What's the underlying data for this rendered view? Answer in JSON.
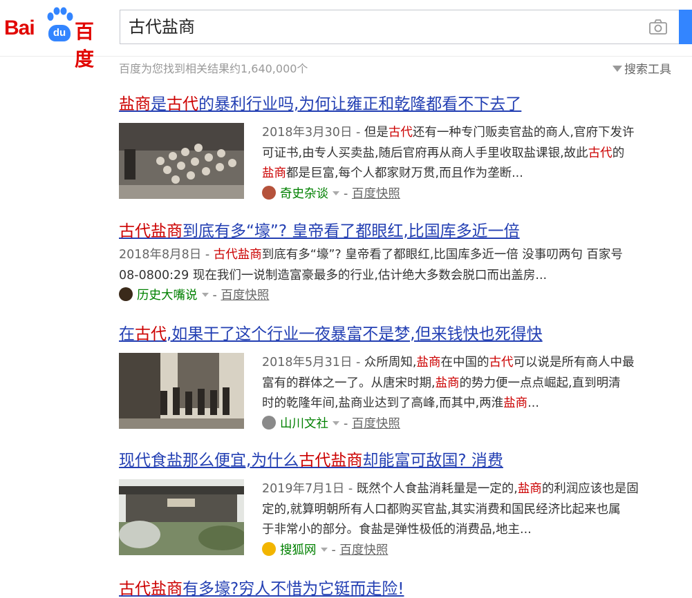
{
  "header": {
    "logo": {
      "bai": "Bai",
      "du": "du",
      "cn": "百度"
    },
    "search": {
      "query": "古代盐商"
    },
    "count_text": "百度为您找到相关结果约1,640,000个",
    "tools_label": "搜索工具"
  },
  "results": [
    {
      "title": [
        {
          "t": "盐商",
          "hl": true
        },
        {
          "t": "是"
        },
        {
          "t": "古代",
          "hl": true
        },
        {
          "t": "的暴利行业吗,为何让雍正和乾隆都看不下去了"
        }
      ],
      "lines": [
        [
          {
            "t": "2018年3月30日 - ",
            "date": true
          },
          {
            "t": "但是"
          },
          {
            "t": "古代",
            "hl": true
          },
          {
            "t": "还有一种专门贩卖官盐的商人,官府下发许"
          }
        ],
        [
          {
            "t": "可证书,由专人买卖盐,随后官府再从商人手里收取盐课银,故此"
          },
          {
            "t": "古代",
            "hl": true
          },
          {
            "t": "的"
          }
        ],
        [
          {
            "t": "盐商",
            "hl": true
          },
          {
            "t": "都是巨富,每个人都家财万贯,而且作为垄断..."
          }
        ]
      ],
      "source": "奇史杂谈",
      "cache": "百度快照",
      "favicon_color": "#b5523b"
    },
    {
      "title": [
        {
          "t": "古代盐商",
          "hl": true
        },
        {
          "t": "到底有多“壕”? 皇帝看了都眼红,比国库多近一倍"
        }
      ],
      "lines": [
        [
          {
            "t": "2018年8月8日 - ",
            "date": true
          },
          {
            "t": "古代盐商",
            "hl": true
          },
          {
            "t": "到底有多“壕”? 皇帝看了都眼红,比国库多近一倍 没事叨两句 百家号"
          }
        ],
        [
          {
            "t": "08-0800:29 现在我们一说制造富豪最多的行业,估计绝大多数会脱口而出盖房..."
          }
        ]
      ],
      "source": "历史大嘴说",
      "cache": "百度快照",
      "favicon_color": "#3a2a1a"
    },
    {
      "title": [
        {
          "t": "在"
        },
        {
          "t": "古代",
          "hl": true
        },
        {
          "t": ",如果干了这个行业一夜暴富不是梦,但来钱快也死得快"
        }
      ],
      "lines": [
        [
          {
            "t": "2018年5月31日 - ",
            "date": true
          },
          {
            "t": "众所周知,"
          },
          {
            "t": "盐商",
            "hl": true
          },
          {
            "t": "在中国的"
          },
          {
            "t": "古代",
            "hl": true
          },
          {
            "t": "可以说是所有商人中最"
          }
        ],
        [
          {
            "t": "富有的群体之一了。从唐宋时期,"
          },
          {
            "t": "盐商",
            "hl": true
          },
          {
            "t": "的势力便一点点崛起,直到明清"
          }
        ],
        [
          {
            "t": "时的乾隆年间,盐商业达到了高峰,而其中,两淮"
          },
          {
            "t": "盐商",
            "hl": true
          },
          {
            "t": "..."
          }
        ]
      ],
      "source": "山川文社",
      "cache": "百度快照",
      "favicon_color": "#8a8a8a"
    },
    {
      "title": [
        {
          "t": "现代食盐那么便宜,为什么"
        },
        {
          "t": "古代盐商",
          "hl": true
        },
        {
          "t": "却能富可敌国? 消费"
        }
      ],
      "lines": [
        [
          {
            "t": "2019年7月1日 - ",
            "date": true
          },
          {
            "t": "既然个人食盐消耗量是一定的,"
          },
          {
            "t": "盐商",
            "hl": true
          },
          {
            "t": "的利润应该也是固"
          }
        ],
        [
          {
            "t": "定的,就算明朝所有人口都购买官盐,其实消费和国民经济比起来也属"
          }
        ],
        [
          {
            "t": "于非常小的部分。食盐是弹性极低的消费品,地主..."
          }
        ]
      ],
      "source": "搜狐网",
      "cache": "百度快照",
      "favicon_color": "#f2b500"
    },
    {
      "title": [
        {
          "t": "古代盐商",
          "hl": true
        },
        {
          "t": "有多壕?穷人不惜为它铤而走险!"
        }
      ]
    }
  ]
}
